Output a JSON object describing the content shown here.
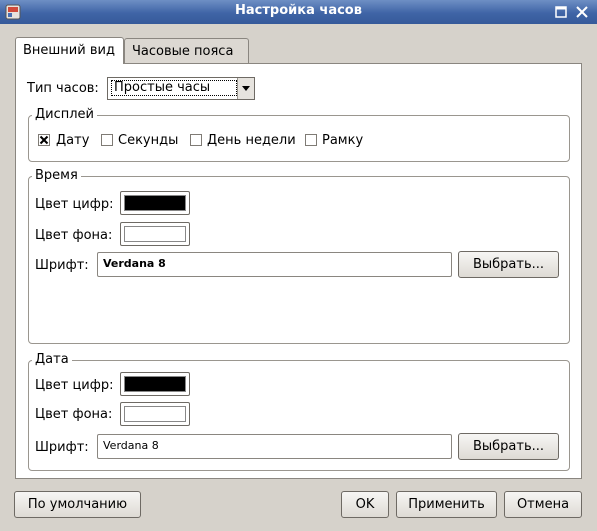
{
  "window": {
    "title": "Настройка часов"
  },
  "tabs": [
    {
      "label": "Внешний вид",
      "active": true
    },
    {
      "label": "Часовые пояса",
      "active": false
    }
  ],
  "clock_type": {
    "label": "Тип часов:",
    "value": "Простые часы"
  },
  "display_group": {
    "title": "Дисплей",
    "options": [
      {
        "label": "Дату",
        "checked": true
      },
      {
        "label": "Секунды",
        "checked": false
      },
      {
        "label": "День недели",
        "checked": false
      },
      {
        "label": "Рамку",
        "checked": false
      }
    ]
  },
  "time_group": {
    "title": "Время",
    "digit_color_label": "Цвет цифр:",
    "digit_color": "#000000",
    "bg_color_label": "Цвет фона:",
    "bg_color": "#ffffff",
    "font_label": "Шрифт:",
    "font_value": "Verdana 8",
    "choose_label": "Выбрать..."
  },
  "date_group": {
    "title": "Дата",
    "digit_color_label": "Цвет цифр:",
    "digit_color": "#000000",
    "bg_color_label": "Цвет фона:",
    "bg_color": "#ffffff",
    "font_label": "Шрифт:",
    "font_value": "Verdana 8",
    "choose_label": "Выбрать..."
  },
  "buttons": {
    "defaults": "По умолчанию",
    "ok": "OK",
    "apply": "Применить",
    "cancel": "Отмена"
  },
  "colors": {
    "titlebar": "#3f64a6",
    "accent": "#d14a3a"
  }
}
